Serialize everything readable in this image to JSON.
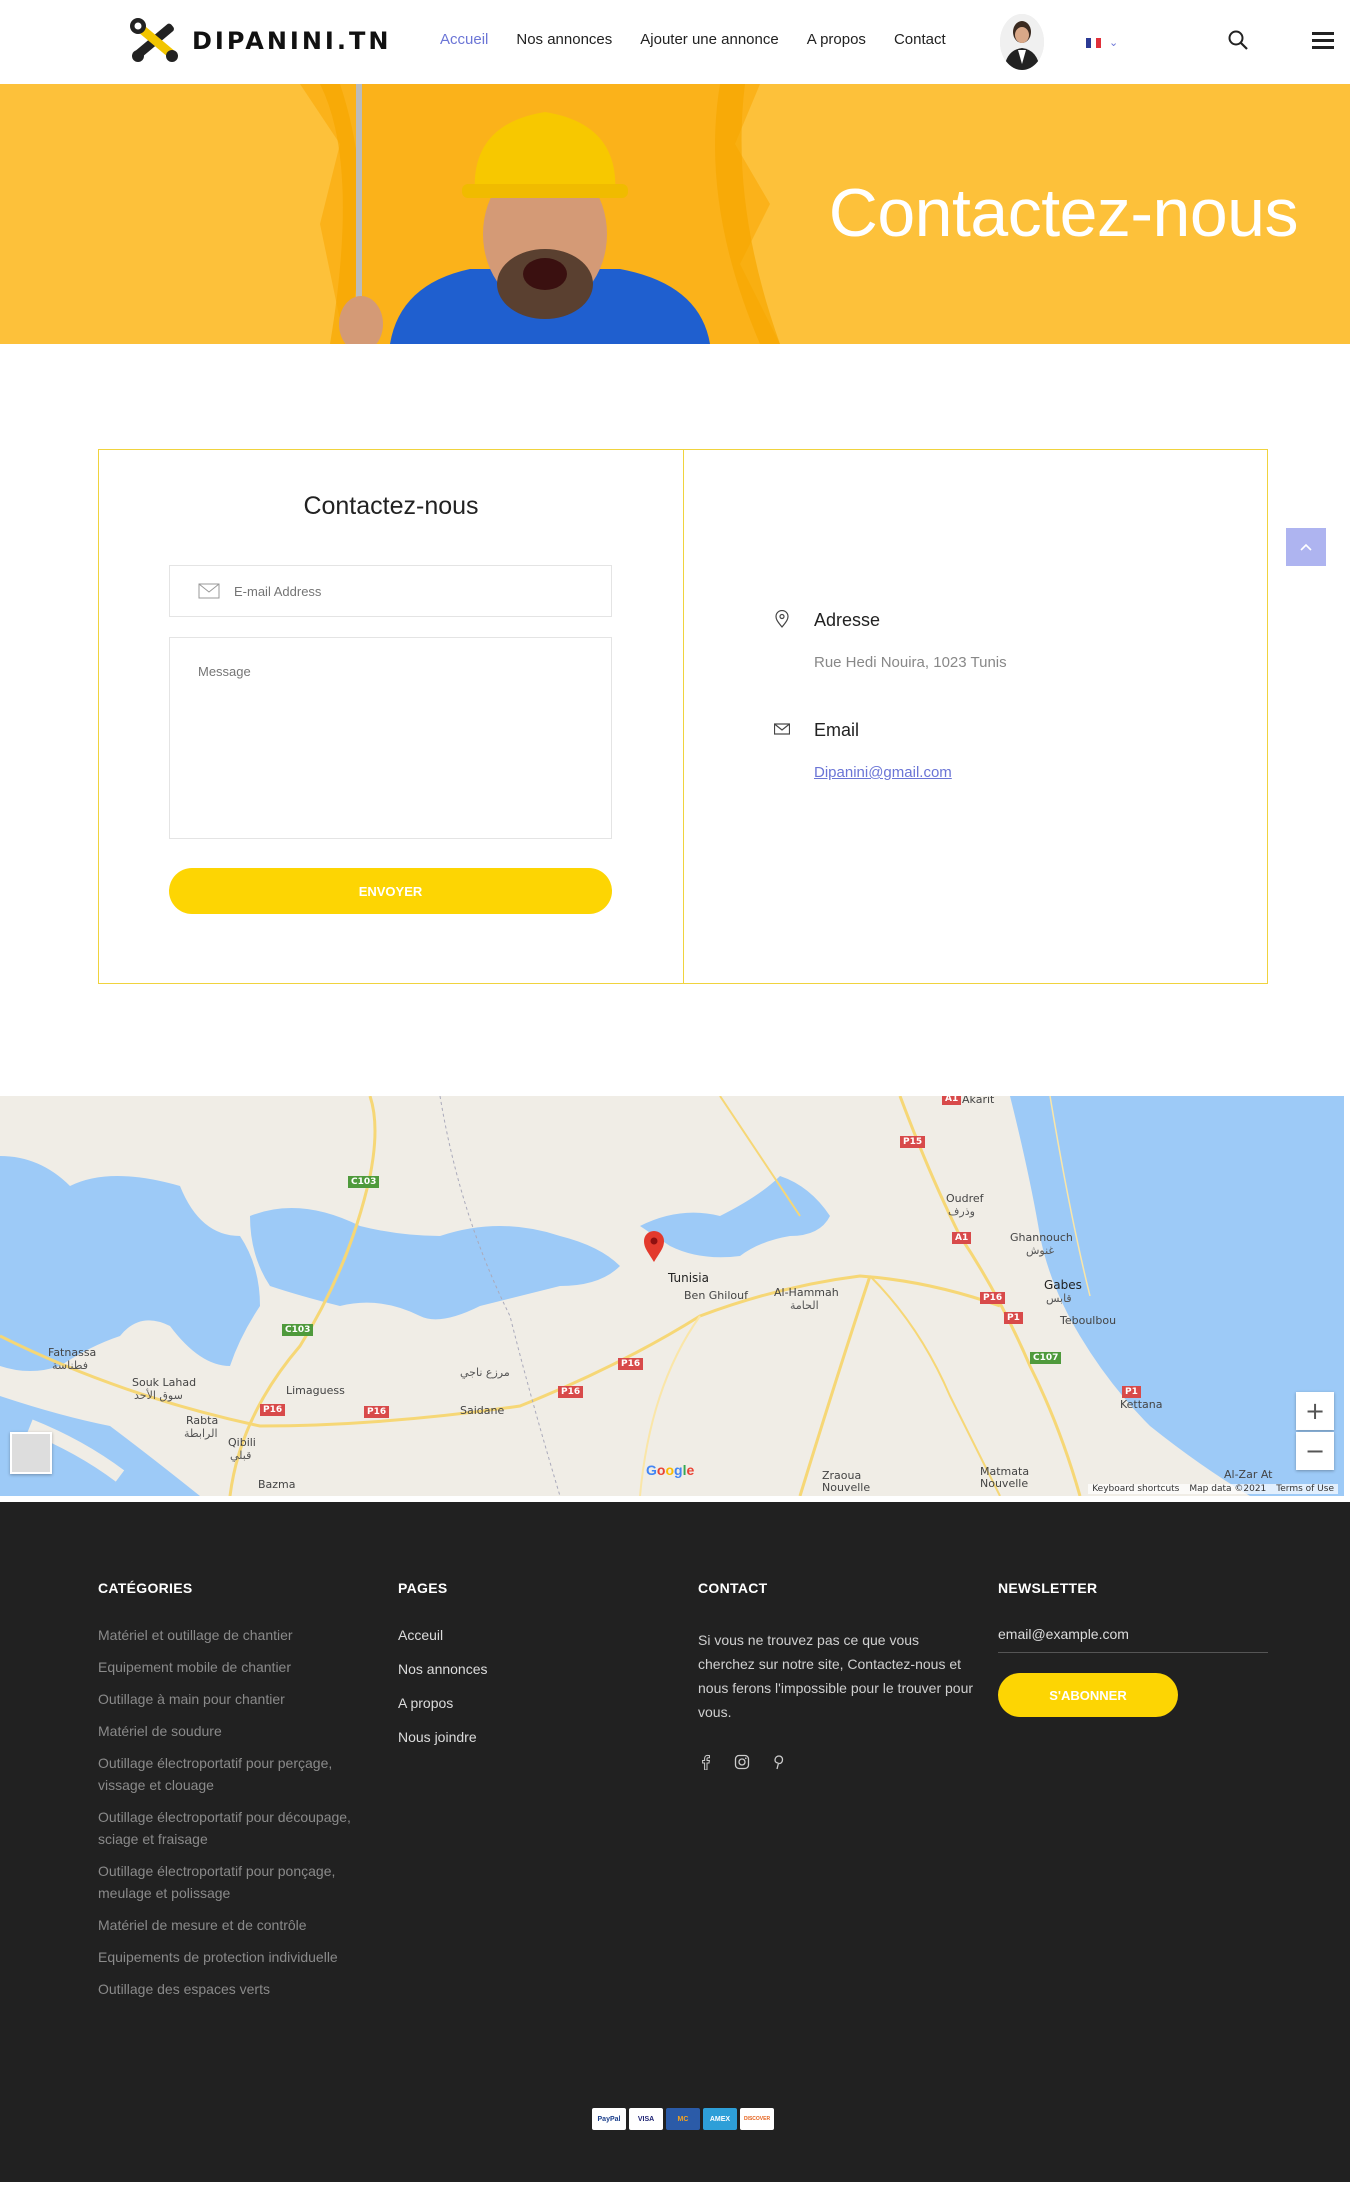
{
  "header": {
    "logo_text": "DIPANINI.TN",
    "nav": [
      "Accueil",
      "Nos annonces",
      "Ajouter une annonce",
      "A propos",
      "Contact"
    ],
    "active_nav": "Accueil",
    "lang_flag": "fr-flag-icon",
    "accent": "#6b75d6"
  },
  "hero": {
    "title": "Contactez-nous",
    "bg_color": "#fdc13a"
  },
  "contact_form": {
    "title": "Contactez-nous",
    "email_placeholder": "E-mail Address",
    "message_placeholder": "Message",
    "submit_label": "ENVOYER",
    "button_color": "#fdd503"
  },
  "contact_info": {
    "address_label": "Adresse",
    "address_value": "Rue Hedi Nouira, 1023 Tunis",
    "email_label": "Email",
    "email_value": "Dipanini@gmail.com"
  },
  "map": {
    "labels": {
      "tunisia": "Tunisia",
      "ben_ghilouf": "Ben Ghilouf",
      "al_hammah": "Al-Hammah",
      "al_hammah_ar": "الحامة",
      "gabes": "Gabes",
      "gabes_ar": "قابس",
      "teboulbou": "Teboulbou",
      "ghannouch": "Ghannouch",
      "ghannouch_ar": "غنوش",
      "oudref": "Oudref",
      "oudref_ar": "وذرف",
      "fatnassa": "Fatnassa",
      "fatnassa_ar": "فطناسة",
      "souk_lahad": "Souk Lahad",
      "souk_lahad_ar": "سوق الأحد",
      "limaguess": "Limaguess",
      "rabta": "Rabta",
      "rabta_ar": "الرابطة",
      "qibili": "Qibili",
      "qibili_ar": "قبلي",
      "saidane": "Saidane",
      "marraa_naji": "مرزع ناجي",
      "bazma": "Bazma",
      "zraoua": "Zraoua\nNouvelle",
      "matmata": "Matmata\nNouvelle",
      "kettana": "Kettana",
      "al_zar": "Al-Zar At",
      "akarit": "Akarit"
    },
    "shields": [
      "P15",
      "C103",
      "A1",
      "P16",
      "P1",
      "C107",
      "P1",
      "C103",
      "P16",
      "P16",
      "P16",
      "P16",
      "A1"
    ],
    "google": "Google",
    "keyboard": "Keyboard shortcuts",
    "map_data": "Map data ©2021",
    "terms": "Terms of Use",
    "zoom_in": "+",
    "zoom_out": "−"
  },
  "footer": {
    "categories_title": "CATÉGORIES",
    "categories": [
      "Matériel et outillage de chantier",
      "Equipement mobile de chantier",
      "Outillage à main pour chantier",
      "Matériel de soudure",
      "Outillage électroportatif pour perçage, vissage et clouage",
      "Outillage électroportatif pour découpage, sciage et fraisage",
      "Outillage électroportatif pour ponçage, meulage et polissage",
      "Matériel de mesure et de contrôle",
      "Equipements de protection individuelle",
      "Outillage des espaces verts"
    ],
    "pages_title": "PAGES",
    "pages": [
      "Acceuil",
      "Nos annonces",
      "A propos",
      "Nous joindre"
    ],
    "contact_title": "CONTACT",
    "contact_text": "Si vous ne trouvez pas ce que vous cherchez sur notre site, Contactez-nous et nous ferons l'impossible pour le trouver pour vous.",
    "newsletter_title": "NEWSLETTER",
    "newsletter_placeholder": "email@example.com",
    "newsletter_button": "S'ABONNER",
    "payments": [
      "PayPal",
      "VISA",
      "MC",
      "AMEX",
      "DISCOVER"
    ]
  }
}
